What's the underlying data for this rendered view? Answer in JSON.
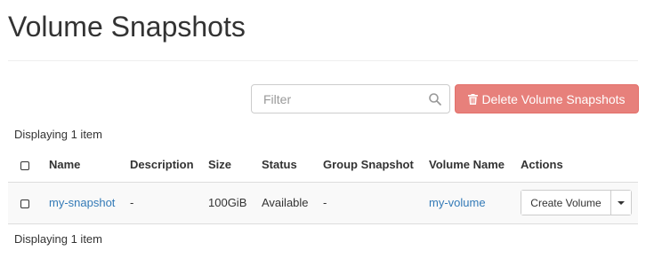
{
  "page": {
    "title": "Volume Snapshots"
  },
  "toolbar": {
    "filter_placeholder": "Filter",
    "filter_value": "",
    "delete_label": "Delete Volume Snapshots",
    "delete_color": "#e7807b"
  },
  "table": {
    "count_label": "Displaying 1 item",
    "columns": [
      "Name",
      "Description",
      "Size",
      "Status",
      "Group Snapshot",
      "Volume Name",
      "Actions"
    ],
    "rows": [
      {
        "name": "my-snapshot",
        "description": "-",
        "size": "100GiB",
        "status": "Available",
        "group_snapshot": "-",
        "volume_name": "my-volume",
        "action_label": "Create Volume"
      }
    ]
  },
  "colors": {
    "link": "#337ab7",
    "danger": "#e7807b"
  }
}
